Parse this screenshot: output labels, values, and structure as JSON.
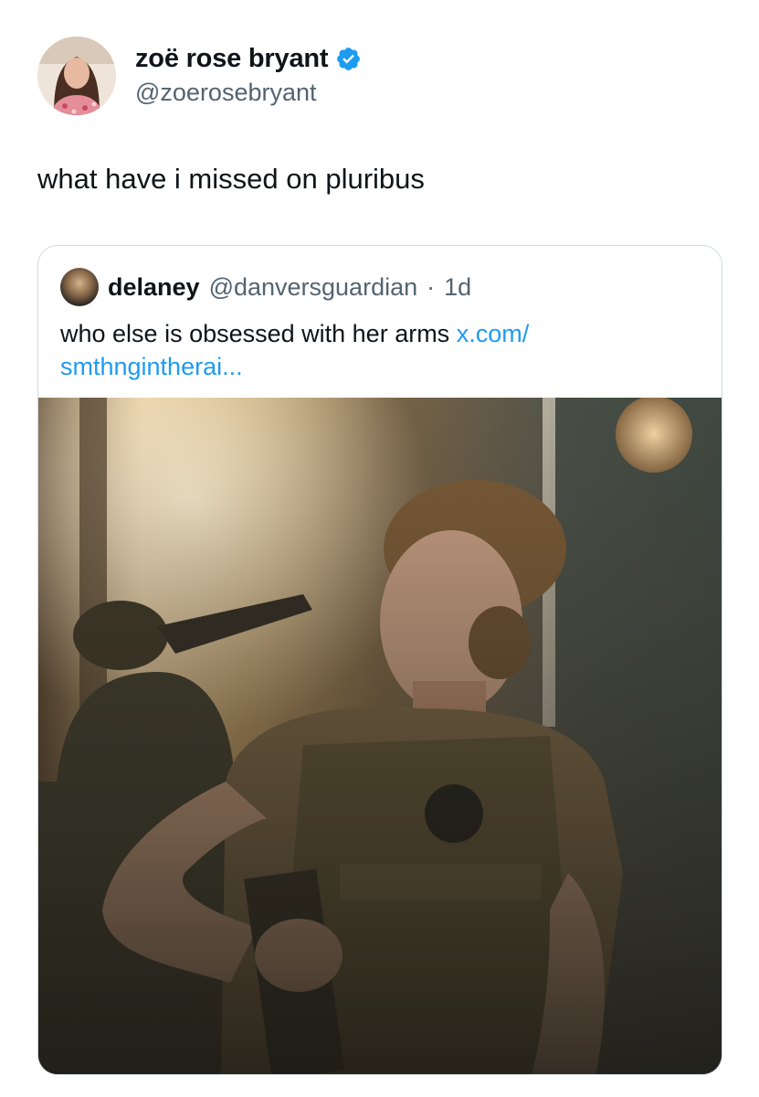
{
  "tweet": {
    "author": {
      "display_name": "zoë rose bryant",
      "handle": "@zoerosebryant",
      "verified": true
    },
    "text": "what have i missed on pluribus"
  },
  "quoted_tweet": {
    "author": {
      "display_name": "delaney",
      "handle": "@danversguardian"
    },
    "separator": "·",
    "time": "1d",
    "text": "who else is obsessed with her arms",
    "link_line1": "x.com/",
    "link_line2": "smthngintherai..."
  },
  "colors": {
    "verified_badge": "#1d9bf0",
    "link": "#1d9bf0",
    "secondary_text": "#536471",
    "card_border": "#cfd9de"
  },
  "icons": {
    "verified": "verified-badge-icon"
  }
}
